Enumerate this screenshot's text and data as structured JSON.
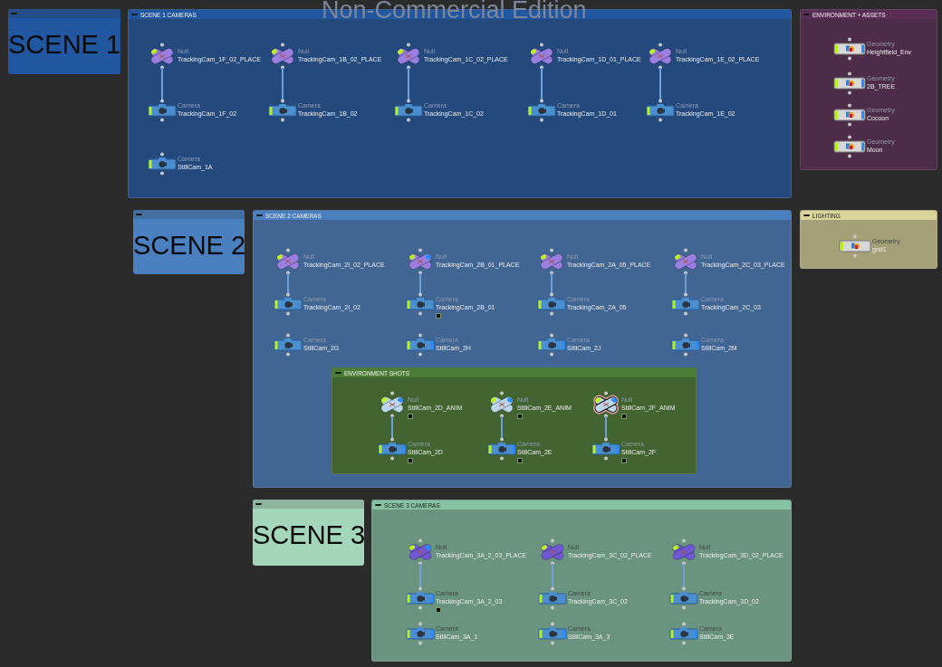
{
  "edition_banner": "Non-Commercial Edition",
  "items": [
    {
      "kind": "sticky",
      "color": "#2157a0",
      "text": "SCENE 1"
    },
    {
      "kind": "network_box",
      "color": "#2156a0",
      "title": "SCENE 1 CAMERAS",
      "columns": [
        [
          {
            "kind": "null",
            "type": "Null",
            "name": "TrackingCam_1F_02_PLACE",
            "color": "#9a7ee0",
            "display": false
          },
          {
            "kind": "camera",
            "type": "Camera",
            "name": "TrackingCam_1F_02",
            "wired": true,
            "display": false
          },
          {
            "kind": "camera",
            "type": "Camera",
            "name": "StillCam_1A",
            "wired": false,
            "display": false
          }
        ],
        [
          {
            "kind": "null",
            "type": "Null",
            "name": "TrackingCam_1B_02_PLACE",
            "color": "#9a7ee0",
            "display": false
          },
          {
            "kind": "camera",
            "type": "Camera",
            "name": "TrackingCam_1B_02",
            "wired": true,
            "display": false
          }
        ],
        [
          {
            "kind": "null",
            "type": "Null",
            "name": "TrackingCam_1C_02_PLACE",
            "color": "#9a7ee0",
            "display": false
          },
          {
            "kind": "camera",
            "type": "Camera",
            "name": "TrackingCam_1C_02",
            "wired": true,
            "display": false
          }
        ],
        [
          {
            "kind": "null",
            "type": "Null",
            "name": "TrackingCam_1D_01_PLACE",
            "color": "#9a7ee0",
            "display": false
          },
          {
            "kind": "camera",
            "type": "Camera",
            "name": "TrackingCam_1D_01",
            "wired": true,
            "display": false
          }
        ],
        [
          {
            "kind": "null",
            "type": "Null",
            "name": "TrackingCam_1E_02_PLACE",
            "color": "#9a7ee0",
            "display": false
          },
          {
            "kind": "camera",
            "type": "Camera",
            "name": "TrackingCam_1E_02",
            "wired": true,
            "display": false
          }
        ]
      ]
    },
    {
      "kind": "network_box",
      "color": "#5a2d55",
      "title": "ENVIRONMENT + ASSETS",
      "columns": [
        [
          {
            "kind": "geometry",
            "type": "Geometry",
            "name": "Heightfield_Env",
            "display": true
          },
          {
            "kind": "geometry",
            "type": "Geometry",
            "name": "2B_TREE",
            "display": true
          },
          {
            "kind": "geometry",
            "type": "Geometry",
            "name": "Cocoon",
            "display": true
          },
          {
            "kind": "geometry",
            "type": "Geometry",
            "name": "Moon",
            "display": true
          }
        ]
      ]
    },
    {
      "kind": "sticky",
      "color": "#4a80c0",
      "text": "SCENE 2"
    },
    {
      "kind": "network_box",
      "color": "#4a7fc0",
      "title": "SCENE 2 CAMERAS",
      "columns": [
        [
          {
            "kind": "null",
            "type": "Null",
            "name": "TrackingCam_2I_02_PLACE",
            "color": "#9a7ee0",
            "display": false
          },
          {
            "kind": "camera",
            "type": "Camera",
            "name": "TrackingCam_2I_02",
            "wired": true,
            "display": false
          },
          {
            "kind": "camera",
            "type": "Camera",
            "name": "StillCam_2G",
            "wired": false,
            "display": false
          }
        ],
        [
          {
            "kind": "null",
            "type": "Null",
            "name": "TrackingCam_2B_01_PLACE",
            "color": "#9a7ee0",
            "display": true
          },
          {
            "kind": "camera",
            "type": "Camera",
            "name": "TrackingCam_2B_01",
            "wired": true,
            "display": false,
            "flagged": true
          },
          {
            "kind": "camera",
            "type": "Camera",
            "name": "StillCam_2H",
            "wired": false,
            "display": true
          }
        ],
        [
          {
            "kind": "null",
            "type": "Null",
            "name": "TrackingCam_2A_05_PLACE",
            "color": "#9a7ee0",
            "display": false
          },
          {
            "kind": "camera",
            "type": "Camera",
            "name": "TrackingCam_2A_05",
            "wired": true,
            "display": false
          },
          {
            "kind": "camera",
            "type": "Camera",
            "name": "StillCam_2J",
            "wired": false,
            "display": true
          }
        ],
        [
          {
            "kind": "null",
            "type": "Null",
            "name": "TrackingCam_2C_03_PLACE",
            "color": "#9a7ee0",
            "display": false
          },
          {
            "kind": "camera",
            "type": "Camera",
            "name": "TrackingCam_2C_03",
            "wired": true,
            "display": false
          },
          {
            "kind": "camera",
            "type": "Camera",
            "name": "StillCam_2M",
            "wired": false,
            "display": true
          }
        ]
      ],
      "boxes": [
        {
          "kind": "network_box",
          "color": "#4c7d34",
          "title": "ENVIRONMENT SHOTS",
          "columns": [
            [
              {
                "kind": "null",
                "type": "Null",
                "name": "StillCam_2D_ANIM",
                "color": "#bcd6ea",
                "display": true,
                "flagged": true
              },
              {
                "kind": "camera",
                "type": "Camera",
                "name": "StillCam_2D",
                "wired": true,
                "display": true,
                "flagged": true
              }
            ],
            [
              {
                "kind": "null",
                "type": "Null",
                "name": "StillCam_2E_ANIM",
                "color": "#bcd6ea",
                "display": true,
                "flagged": true
              },
              {
                "kind": "camera",
                "type": "Camera",
                "name": "StillCam_2E",
                "wired": true,
                "display": true,
                "flagged": true
              }
            ],
            [
              {
                "kind": "null",
                "type": "Null",
                "name": "StillCam_2F_ANIM",
                "color": "#bcd6ea",
                "display": true,
                "flagged": true,
                "highlighted": true
              },
              {
                "kind": "camera",
                "type": "Camera",
                "name": "StillCam_2F",
                "wired": true,
                "display": true,
                "flagged": true
              }
            ]
          ]
        }
      ]
    },
    {
      "kind": "network_box",
      "color": "#d8d49a",
      "title": "LIGHTING",
      "columns": [
        [
          {
            "kind": "geometry",
            "type": "Geometry",
            "name": "grid1",
            "display": false
          }
        ]
      ]
    },
    {
      "kind": "sticky",
      "color": "#a4d6bc",
      "text": "SCENE 3"
    },
    {
      "kind": "network_box",
      "color": "#86c1a4",
      "title": "SCENE 3 CAMERAS",
      "columns": [
        [
          {
            "kind": "null",
            "type": "Null",
            "name": "TrackingCam_3A_2_03_PLACE",
            "color": "#7058d4",
            "display": true
          },
          {
            "kind": "camera",
            "type": "Camera",
            "name": "TrackingCam_3A_2_03",
            "wired": true,
            "display": true,
            "flagged": true
          },
          {
            "kind": "camera",
            "type": "Camera",
            "name": "StillCam_3A_1",
            "wired": false,
            "display": true
          }
        ],
        [
          {
            "kind": "null",
            "type": "Null",
            "name": "TrackingCam_3C_02_PLACE",
            "color": "#7058d4",
            "display": false
          },
          {
            "kind": "camera",
            "type": "Camera",
            "name": "TrackingCam_3C_02",
            "wired": true,
            "display": false
          },
          {
            "kind": "camera",
            "type": "Camera",
            "name": "StillCam_3A_3",
            "wired": false,
            "display": true
          }
        ],
        [
          {
            "kind": "null",
            "type": "Null",
            "name": "TrackingCam_3D_02_PLACE",
            "color": "#7058d4",
            "display": false
          },
          {
            "kind": "camera",
            "type": "Camera",
            "name": "TrackingCam_3D_02",
            "wired": true,
            "display": false
          },
          {
            "kind": "camera",
            "type": "Camera",
            "name": "StillCam_3E",
            "wired": false,
            "display": true
          }
        ]
      ]
    }
  ]
}
